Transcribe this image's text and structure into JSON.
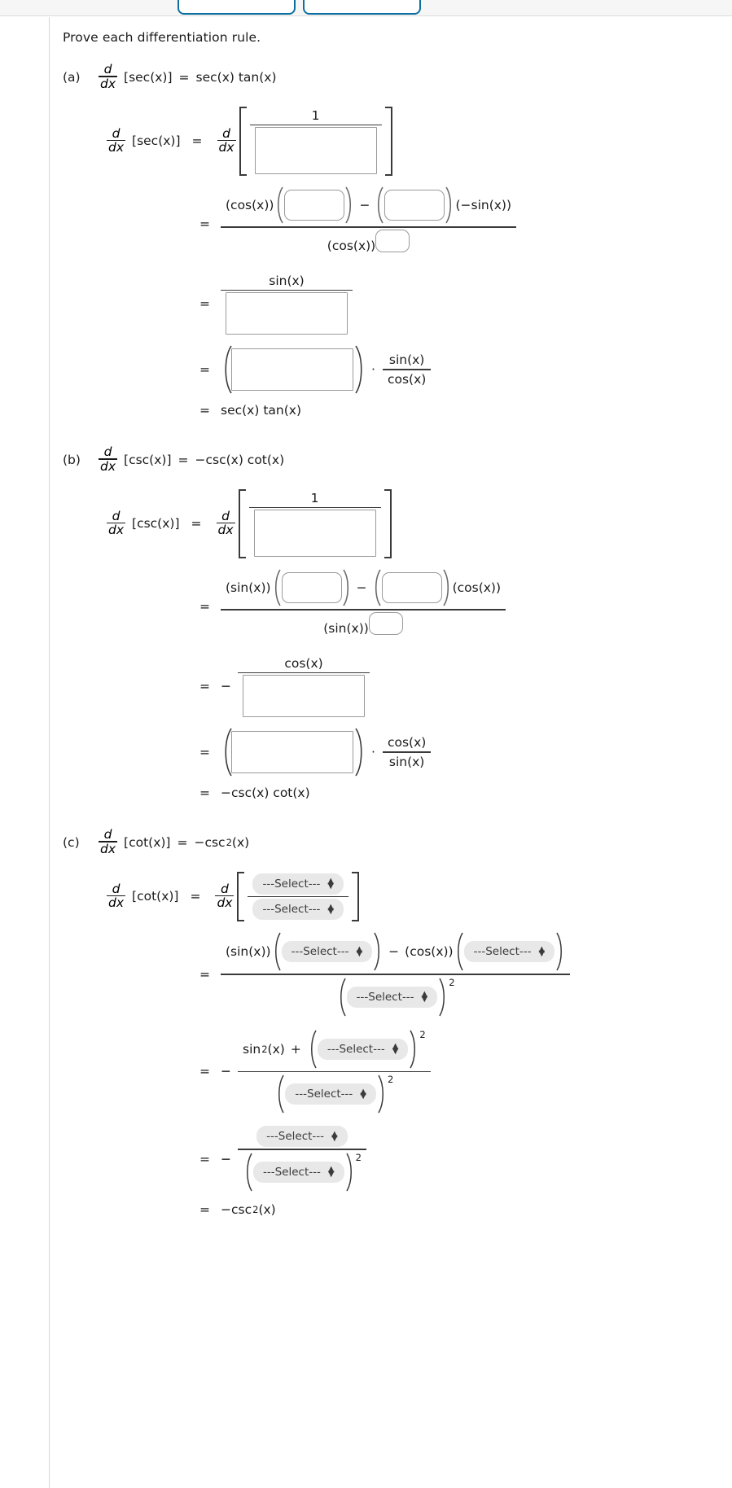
{
  "top_chrome": {
    "buttons": [
      {
        "name": "toolbar-button-1",
        "label": ""
      },
      {
        "name": "toolbar-button-2",
        "label": ""
      }
    ]
  },
  "prompt": "Prove each differentiation rule.",
  "select_placeholder": "---Select---",
  "parts": [
    {
      "id": "a",
      "label": "(a)",
      "statement": {
        "operator_num": "d",
        "operator_den": "dx",
        "bracket_arg": "[sec(x)]",
        "equals": "=",
        "rhs": "sec(x) tan(x)"
      },
      "lines": [
        {
          "kind": "derivative-of-fraction",
          "lhs_num": "d",
          "lhs_den": "dx",
          "lhs_arg": "[sec(x)]",
          "eq": "=",
          "op_num": "d",
          "op_den": "dx",
          "frac_numerator_text": "1",
          "frac_denominator_input": "box-big"
        },
        {
          "kind": "quotient-rule",
          "eq": "=",
          "num_prefix": "(cos(x))",
          "num_input_1": "box-small",
          "num_minus": "−",
          "num_input_2": "box-small",
          "num_suffix": "(−sin(x))",
          "den_base": "(cos(x))",
          "den_exponent_input": "box-exp"
        },
        {
          "kind": "simple-fraction",
          "eq": "=",
          "numerator_text": "sin(x)",
          "denominator_input": "box-med"
        },
        {
          "kind": "product-with-fraction",
          "eq": "=",
          "paren_input": "box-med",
          "dot": "·",
          "frac_num": "sin(x)",
          "frac_den": "cos(x)"
        },
        {
          "kind": "final",
          "eq": "=",
          "result": "sec(x) tan(x)"
        }
      ]
    },
    {
      "id": "b",
      "label": "(b)",
      "statement": {
        "operator_num": "d",
        "operator_den": "dx",
        "bracket_arg": "[csc(x)]",
        "equals": "=",
        "rhs": "−csc(x) cot(x)"
      },
      "lines": [
        {
          "kind": "derivative-of-fraction",
          "lhs_num": "d",
          "lhs_den": "dx",
          "lhs_arg": "[csc(x)]",
          "eq": "=",
          "op_num": "d",
          "op_den": "dx",
          "frac_numerator_text": "1",
          "frac_denominator_input": "box-big"
        },
        {
          "kind": "quotient-rule",
          "eq": "=",
          "num_prefix": "(sin(x))",
          "num_input_1": "box-small",
          "num_minus": "−",
          "num_input_2": "box-small",
          "num_suffix": "(cos(x))",
          "den_base": "(sin(x))",
          "den_exponent_input": "box-exp"
        },
        {
          "kind": "simple-fraction-negative",
          "eq": "=",
          "sign": "−",
          "numerator_text": "cos(x)",
          "denominator_input": "box-med"
        },
        {
          "kind": "product-with-fraction",
          "eq": "=",
          "paren_input": "box-med",
          "dot": "·",
          "frac_num": "cos(x)",
          "frac_den": "sin(x)"
        },
        {
          "kind": "final",
          "eq": "=",
          "result": "−csc(x) cot(x)"
        }
      ]
    },
    {
      "id": "c",
      "label": "(c)",
      "statement": {
        "operator_num": "d",
        "operator_den": "dx",
        "bracket_arg": "[cot(x)]",
        "equals": "=",
        "rhs_base": "−csc",
        "rhs_exp": "2",
        "rhs_tail": "(x)"
      },
      "lines": [
        {
          "kind": "derivative-of-select-fraction",
          "lhs_num": "d",
          "lhs_den": "dx",
          "lhs_arg": "[cot(x)]",
          "eq": "=",
          "op_num": "d",
          "op_den": "dx",
          "frac_numerator_select": "---Select---",
          "frac_denominator_select": "---Select---"
        },
        {
          "kind": "quotient-rule-select",
          "eq": "=",
          "num_prefix": "(sin(x))",
          "num_select_1": "---Select---",
          "num_minus": "−",
          "num_mid": "(cos(x))",
          "num_select_2": "---Select---",
          "den_select": "---Select---",
          "den_exp": "2"
        },
        {
          "kind": "sin-squared-line",
          "eq": "=",
          "sign": "−",
          "num_lead_base": "sin",
          "num_lead_exp": "2",
          "num_lead_tail": "(x)",
          "num_plus": "+",
          "num_select": "---Select---",
          "num_exp": "2",
          "den_select": "---Select---",
          "den_exp": "2"
        },
        {
          "kind": "select-over-select",
          "eq": "=",
          "sign": "−",
          "num_select": "---Select---",
          "den_select": "---Select---",
          "den_exp": "2"
        },
        {
          "kind": "final-squared",
          "eq": "=",
          "result_base": "−csc",
          "result_exp": "2",
          "result_tail": "(x)"
        }
      ]
    }
  ]
}
